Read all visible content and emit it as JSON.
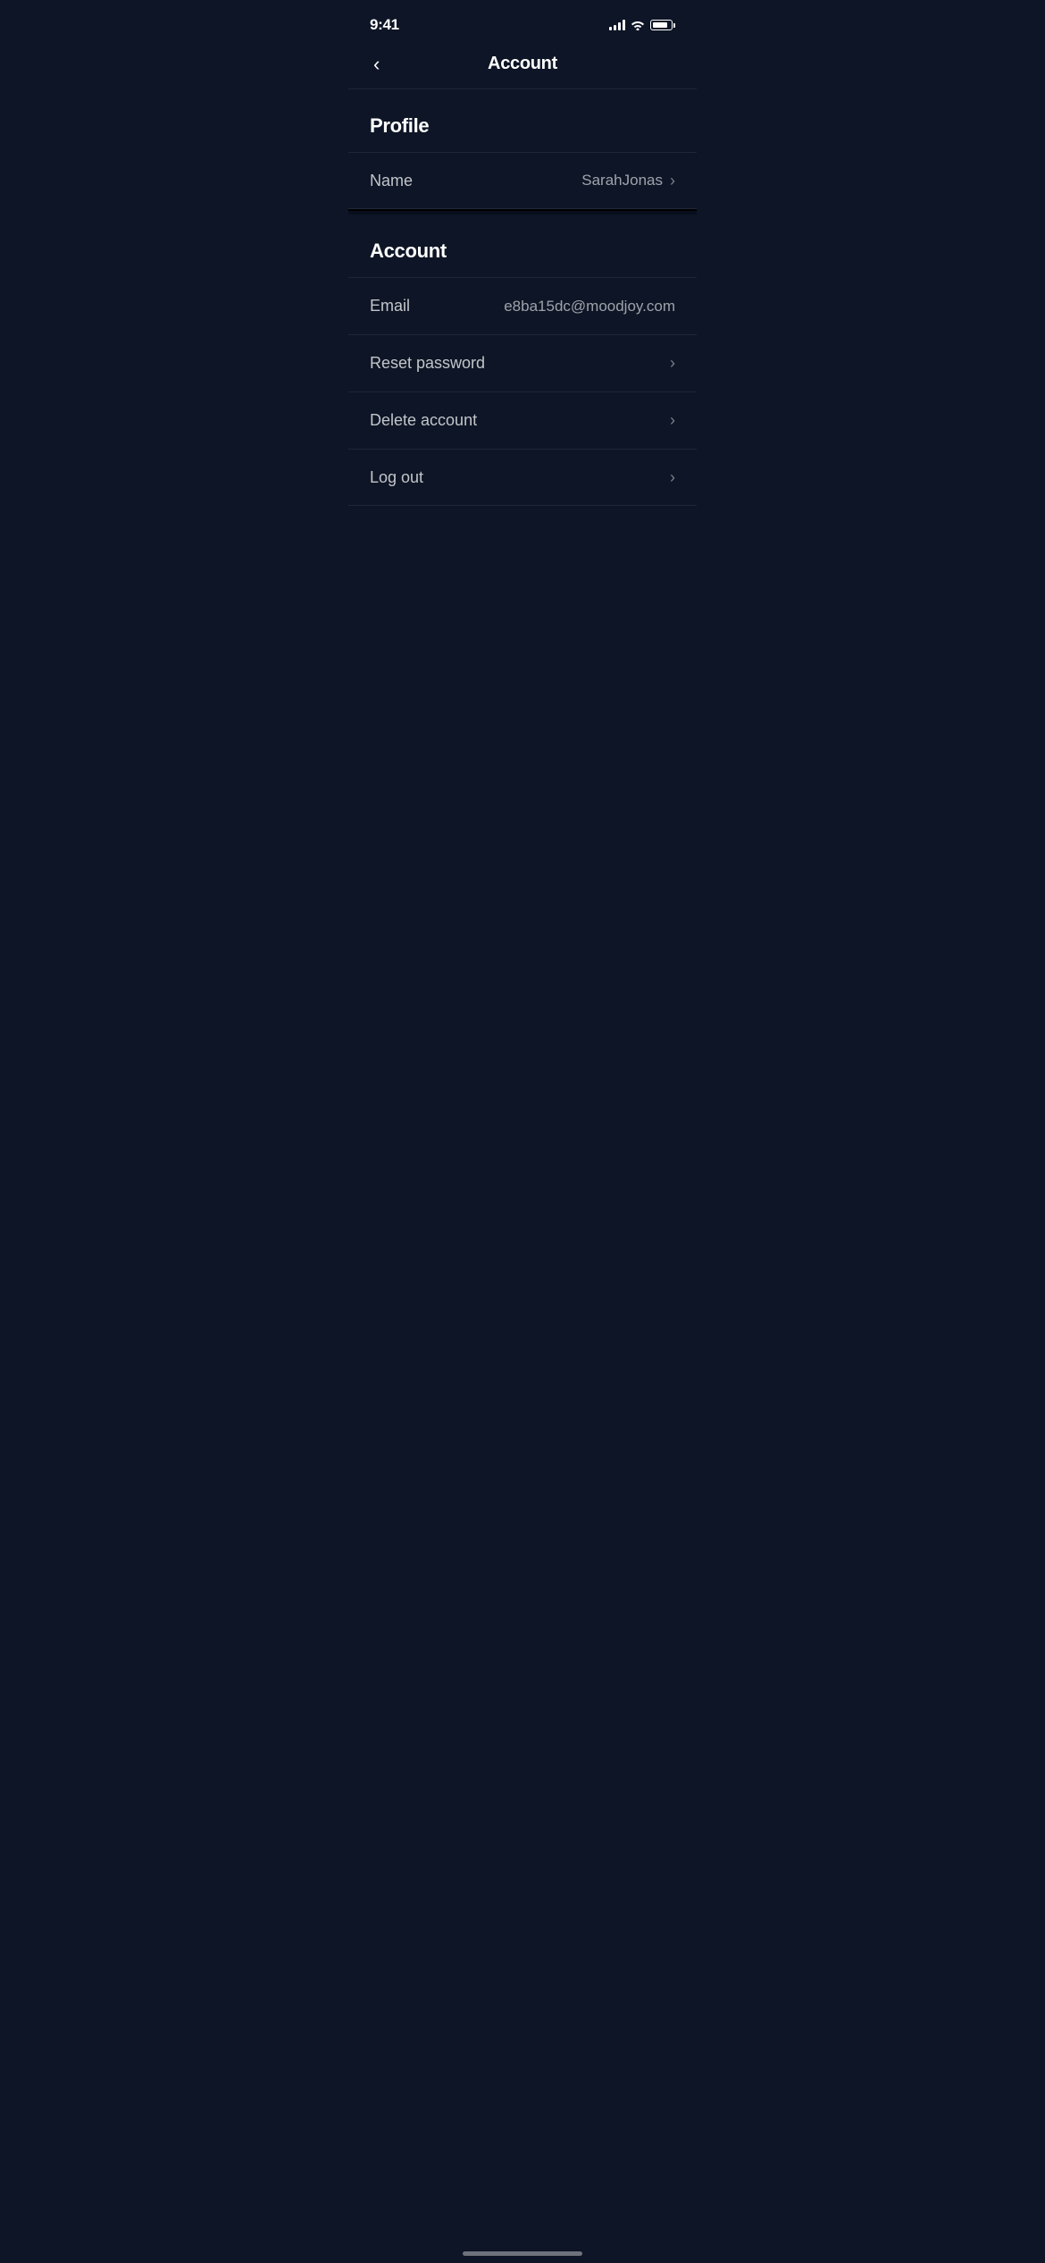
{
  "statusBar": {
    "time": "9:41",
    "signalBars": 4,
    "wifiOn": true,
    "batteryLevel": 85
  },
  "navBar": {
    "backLabel": "‹",
    "title": "Account"
  },
  "sections": [
    {
      "id": "profile",
      "header": "Profile",
      "items": [
        {
          "id": "name",
          "label": "Name",
          "value": "SarahJonas",
          "hasChevron": true,
          "hasValue": true
        }
      ]
    },
    {
      "id": "account",
      "header": "Account",
      "items": [
        {
          "id": "email",
          "label": "Email",
          "value": "e8ba15dc@moodjoy.com",
          "hasChevron": false,
          "hasValue": true
        },
        {
          "id": "reset-password",
          "label": "Reset password",
          "value": "",
          "hasChevron": true,
          "hasValue": false
        },
        {
          "id": "delete-account",
          "label": "Delete account",
          "value": "",
          "hasChevron": true,
          "hasValue": false
        },
        {
          "id": "log-out",
          "label": "Log out",
          "value": "",
          "hasChevron": true,
          "hasValue": false
        }
      ]
    }
  ],
  "homeIndicator": true
}
